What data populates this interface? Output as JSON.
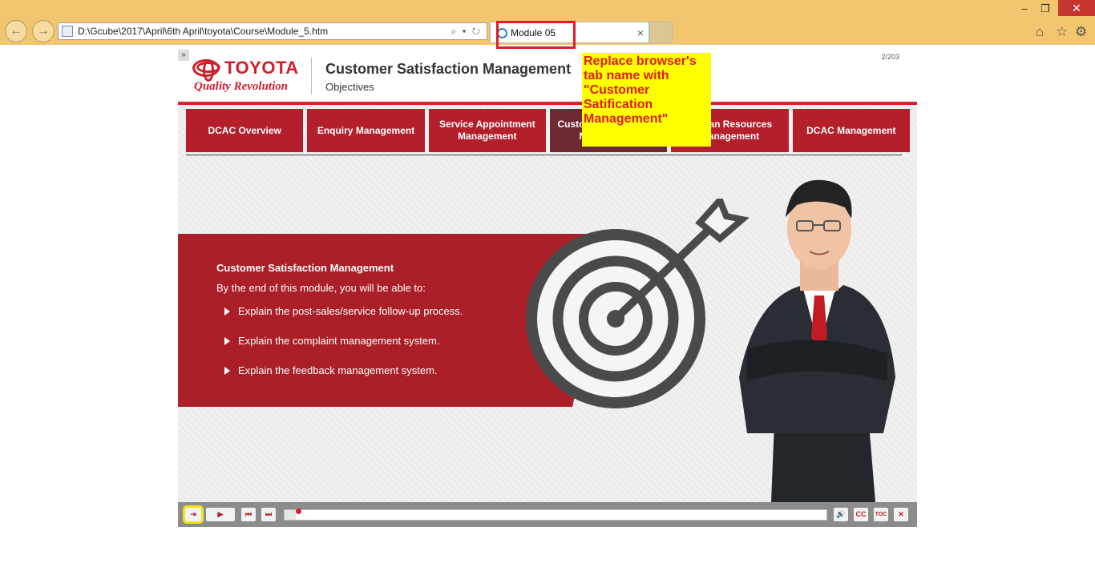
{
  "browser": {
    "address": "D:\\Gcube\\2017\\April\\6th April\\toyota\\Course\\Module_5.htm",
    "tab_title": "Module 05",
    "tab_close": "×",
    "address_tools": "⌕ ▾ ↻"
  },
  "course": {
    "brand": "TOYOTA",
    "tagline": "Quality Revolution",
    "title": "Customer Satisfaction Management",
    "subtitle": "Objectives",
    "page_counter": "2/203",
    "tabs": [
      {
        "label": "DCAC Overview"
      },
      {
        "label": "Enquiry Management"
      },
      {
        "label": "Service Appointment Management"
      },
      {
        "label": "Customer Satisfaction Management"
      },
      {
        "label": "Human Resources Management"
      },
      {
        "label": "DCAC Management"
      }
    ],
    "section_title": "Customer Satisfaction Management",
    "intro": "By the end of this module, you will be able to:",
    "objectives": [
      "Explain the post-sales/service follow-up process.",
      "Explain the complaint management system.",
      "Explain the feedback management system."
    ],
    "progress_fraction": 0.02,
    "controls": {
      "exit": "⇥",
      "play": "▶",
      "prev": "⏮",
      "next": "⏭",
      "audio": "🔊",
      "cc": "CC",
      "toc": "TOC",
      "close": "✕"
    },
    "colors": {
      "accent": "#b3202b",
      "highlight": "#ffff00"
    }
  },
  "annotation": {
    "note": "Replace browser's tab name with \"Customer Satification Management\""
  }
}
